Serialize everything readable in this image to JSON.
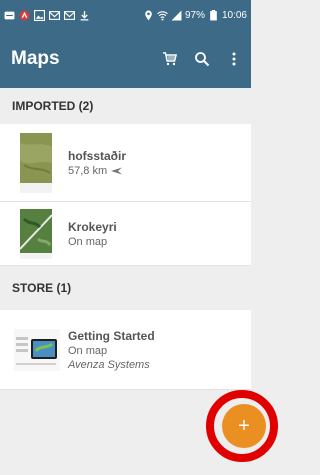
{
  "status_bar": {
    "battery": "97%",
    "time": "10:06"
  },
  "app": {
    "title": "Maps"
  },
  "sections": [
    {
      "title": "IMPORTED (2)"
    },
    {
      "title": "STORE (1)"
    }
  ],
  "maps": [
    {
      "title": "hofsstaðir",
      "subtitle": "57,8 km"
    },
    {
      "title": "Krokeyri",
      "subtitle": "On map"
    },
    {
      "title": "Getting Started",
      "subtitle": "On map",
      "publisher": "Avenza Systems"
    }
  ],
  "fab": {
    "label": "+"
  },
  "colors": {
    "app_bar": "#3d6a87",
    "fab": "#ea8f22",
    "highlight_ring": "#e00000"
  },
  "icons": [
    "cart-icon",
    "search-icon",
    "overflow-menu-icon",
    "direction-arrow-icon",
    "add-icon"
  ]
}
